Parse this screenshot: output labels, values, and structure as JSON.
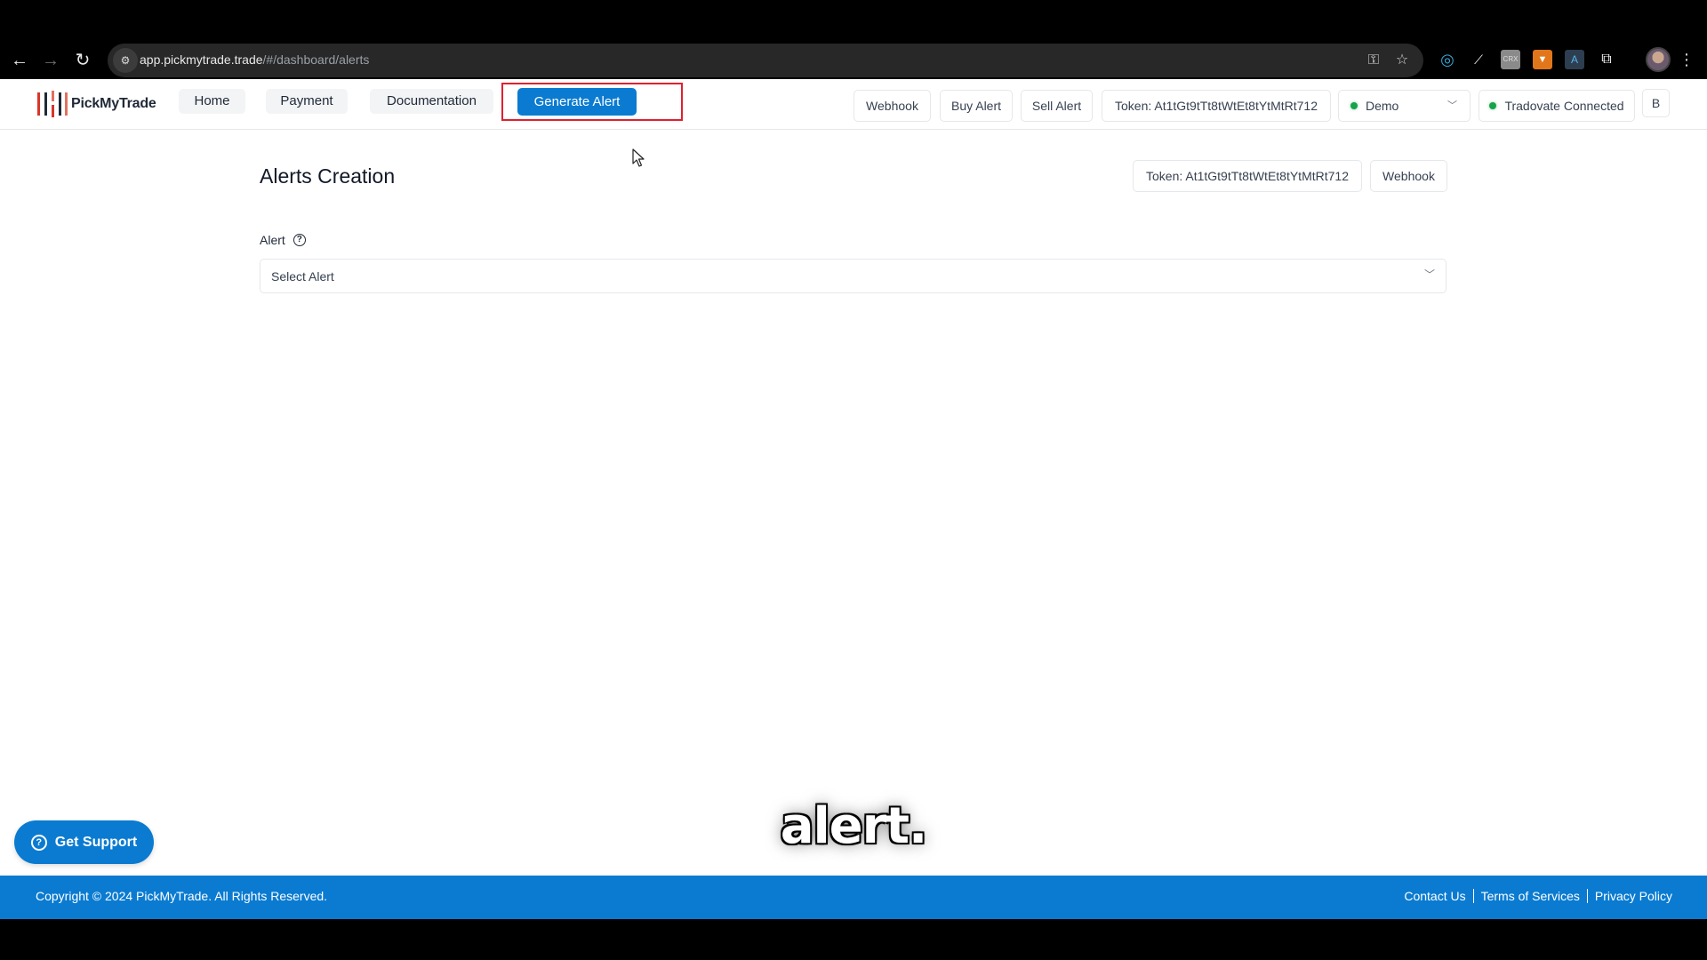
{
  "browser": {
    "url_host": "app.pickmytrade.trade",
    "url_path": "/#/dashboard/alerts",
    "extensions": [
      {
        "name": "web-extension-icon",
        "glyph": "◎",
        "color": "#3aa7d8"
      },
      {
        "name": "broom-extension-icon",
        "glyph": "🧹",
        "color": "#ffffff"
      },
      {
        "name": "crx-extension-icon",
        "glyph": "CRX",
        "color": "#9a9a9a"
      },
      {
        "name": "metamask-fox-icon",
        "glyph": "🦊",
        "color": "#e2761b"
      },
      {
        "name": "compass-extension-icon",
        "glyph": "A",
        "color": "#5ab0e6"
      },
      {
        "name": "puzzle-extensions-icon",
        "glyph": "⧉",
        "color": "#ffffff"
      }
    ]
  },
  "header": {
    "brand": "PickMyTrade",
    "nav": [
      {
        "label": "Home"
      },
      {
        "label": "Payment"
      },
      {
        "label": "Documentation"
      }
    ],
    "generate_alert_label": "Generate Alert",
    "right": {
      "webhook_label": "Webhook",
      "buy_alert_label": "Buy Alert",
      "sell_alert_label": "Sell Alert",
      "token_label": "Token: At1tGt9tTt8tWtEt8tYtMtRt712",
      "account_select": "Demo",
      "connection_status": "Tradovate Connected",
      "user_initial": "B"
    }
  },
  "main": {
    "title": "Alerts Creation",
    "token_label": "Token: At1tGt9tTt8tWtEt8tYtMtRt712",
    "webhook_label": "Webhook",
    "alert_field": {
      "label": "Alert",
      "placeholder": "Select Alert"
    }
  },
  "support_label": "Get Support",
  "caption": "alert.",
  "footer": {
    "copyright": "Copyright © 2024 PickMyTrade. All Rights Reserved.",
    "links": [
      {
        "label": "Contact Us"
      },
      {
        "label": "Terms of Services"
      },
      {
        "label": "Privacy Policy"
      }
    ]
  },
  "colors": {
    "brand_blue": "#0a7bd1",
    "highlight_red": "#e0202e",
    "status_green": "#16a34a"
  }
}
